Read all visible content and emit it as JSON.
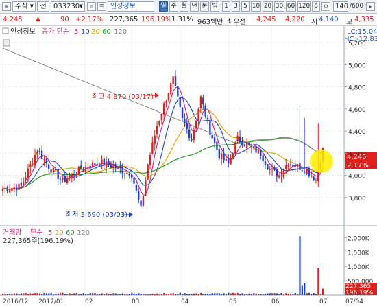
{
  "toolbar": {
    "market_type": "주식",
    "market_sub": "전",
    "stock_code": "033230",
    "stock_name": "인성정보",
    "period_tabs": [
      "일",
      "주",
      "월",
      "년",
      "분",
      "틱"
    ],
    "active_period": "일",
    "interval_buttons": [
      "1",
      "3",
      "5",
      "10",
      "20",
      "30",
      "60",
      "120",
      "6"
    ],
    "count_value": "140",
    "count_total": "600"
  },
  "infobar": {
    "price": "4,245",
    "change_arrow": "▲",
    "change": "90",
    "change_rate": "+2.17%",
    "volume": "227,365",
    "volume_ratio": "196.19%",
    "turnover_ratio": "1.31%",
    "trade_amount": "963백만",
    "quote_label": "최우선",
    "ask": "4,245",
    "bid": "4,220",
    "open_label": "시",
    "open": "4,140",
    "high_label": "고",
    "high": "4,335"
  },
  "price_panel": {
    "title": "인성정보",
    "indicator": "종가 단순",
    "ma_periods": [
      "5",
      "10",
      "20",
      "60",
      "120"
    ],
    "lc_label": "LC:15.04",
    "hc_label": "HC:-12.83",
    "max_annotation": "최고 4,870 (03/17)",
    "min_annotation": "최저 3,690 (03/03)",
    "current_price_tag": "4,245",
    "current_rate_tag": "2.17%",
    "y_ticks": [
      "5,200",
      "5,000",
      "4,800",
      "4,600",
      "4,400",
      "4,200",
      "4,000",
      "3,800"
    ]
  },
  "volume_panel": {
    "title": "거래량",
    "indicator": "단순",
    "ma_periods": [
      "5",
      "20",
      "60",
      "120"
    ],
    "summary": "227,365주(196.19%)",
    "current_volume_tag": "227,365",
    "current_ratio_tag": "196.19%",
    "y_ticks": [
      "2,000K",
      "1,500K",
      "1,000K",
      "500,000"
    ]
  },
  "x_ticks": [
    "2016/12",
    "2017/01",
    "02",
    "03",
    "04",
    "05",
    "06",
    "07",
    "07/04"
  ],
  "colors": {
    "up": "#e0201b",
    "down": "#1c3fd0",
    "ma5": "#d6268a",
    "ma10": "#2450c8",
    "ma20": "#e8a000",
    "ma60": "#2aa02a",
    "ma120": "#888888",
    "highlight": "#ffee00"
  },
  "chart_data": {
    "type": "candlestick",
    "price_range": [
      3600,
      5300
    ],
    "volume_range": [
      0,
      2200000
    ],
    "highest": {
      "value": 4870,
      "date": "03/17"
    },
    "lowest": {
      "value": 3690,
      "date": "03/03"
    },
    "last_close": 4245,
    "last_volume": 227365
  }
}
